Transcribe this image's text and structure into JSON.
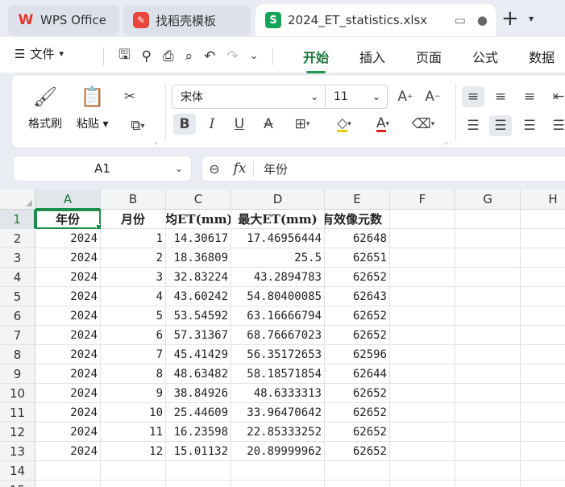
{
  "tabs": [
    {
      "label": "WPS Office"
    },
    {
      "label": "找稻壳模板"
    },
    {
      "label": "2024_ET_statistics.xlsx"
    }
  ],
  "menu": {
    "file_label": "文件",
    "ribbon_tabs": [
      "开始",
      "插入",
      "页面",
      "公式",
      "数据"
    ]
  },
  "ribbon": {
    "format_painter": "格式刷",
    "paste": "粘贴",
    "font_name": "宋体",
    "font_size": "11"
  },
  "formula_bar": {
    "cell_ref": "A1",
    "value": "年份"
  },
  "sheet": {
    "columns": [
      "A",
      "B",
      "C",
      "D",
      "E",
      "F",
      "G",
      "H"
    ],
    "headers": [
      "年份",
      "月份",
      "月均ET(mm)",
      "最大ET(mm)",
      "有效像元数"
    ],
    "rows": [
      [
        "2024",
        "1",
        "14.30617",
        "17.46956444",
        "62648"
      ],
      [
        "2024",
        "2",
        "18.36809",
        "25.5",
        "62651"
      ],
      [
        "2024",
        "3",
        "32.83224",
        "43.2894783",
        "62652"
      ],
      [
        "2024",
        "4",
        "43.60242",
        "54.80400085",
        "62643"
      ],
      [
        "2024",
        "5",
        "53.54592",
        "63.16666794",
        "62652"
      ],
      [
        "2024",
        "6",
        "57.31367",
        "68.76667023",
        "62652"
      ],
      [
        "2024",
        "7",
        "45.41429",
        "56.35172653",
        "62596"
      ],
      [
        "2024",
        "8",
        "48.63482",
        "58.18571854",
        "62644"
      ],
      [
        "2024",
        "9",
        "38.84926",
        "48.6333313",
        "62652"
      ],
      [
        "2024",
        "10",
        "25.44609",
        "33.96470642",
        "62652"
      ],
      [
        "2024",
        "11",
        "16.23598",
        "22.85333252",
        "62652"
      ],
      [
        "2024",
        "12",
        "15.01132",
        "20.89999962",
        "62652"
      ]
    ],
    "row_numbers": [
      "1",
      "2",
      "3",
      "4",
      "5",
      "6",
      "7",
      "8",
      "9",
      "10",
      "11",
      "12",
      "13",
      "14",
      "15"
    ]
  }
}
